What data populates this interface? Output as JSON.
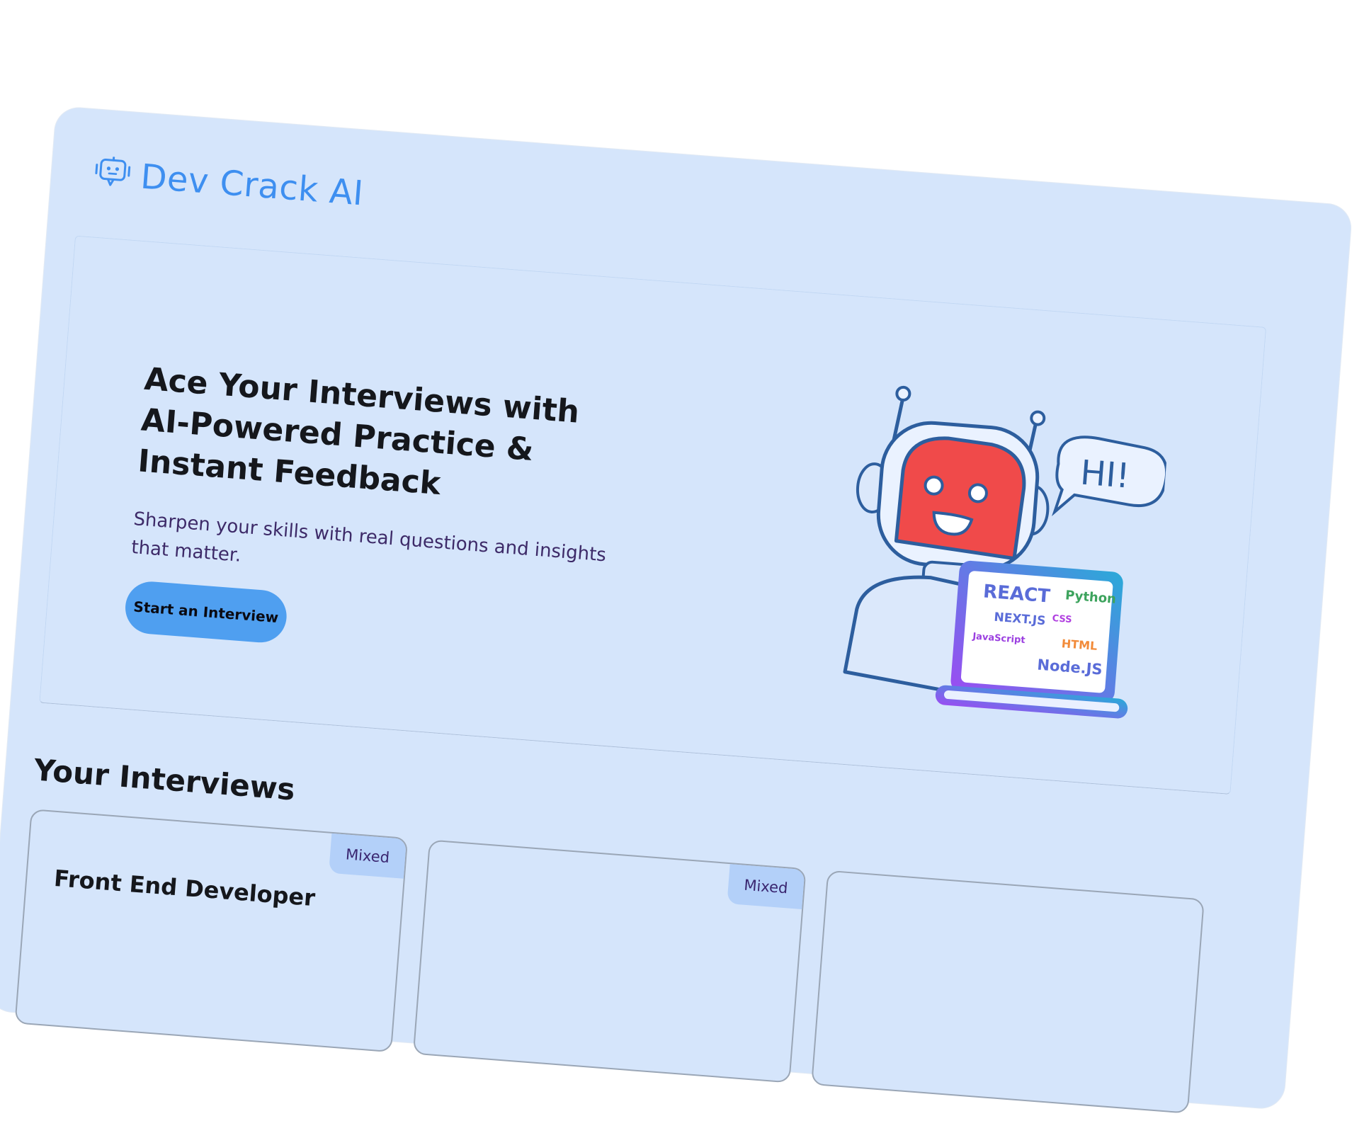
{
  "brand": {
    "name": "Dev Crack AI",
    "icon": "chat-robot-icon",
    "color": "#3e8ff0"
  },
  "hero": {
    "title": "Ace Your Interviews with AI-Powered Practice & Instant Feedback",
    "subtitle": "Sharpen your skills with real questions and insights that matter.",
    "cta_label": "Start an Interview",
    "illustration": {
      "speech": "HI!",
      "tech_labels": [
        "REACT",
        "Python",
        "NEXT.JS",
        "CSS",
        "JavaScript",
        "HTML",
        "Node.JS"
      ]
    }
  },
  "interviews": {
    "section_title": "Your Interviews",
    "cards": [
      {
        "badge": "Mixed",
        "title": "Front End Developer"
      },
      {
        "badge": "Mixed",
        "title": ""
      },
      {
        "badge": "",
        "title": ""
      }
    ]
  },
  "colors": {
    "background": "#d5e5fb",
    "accent": "#4f9ff0",
    "badge_bg": "#b3d0f9",
    "robot_face": "#f04a4a"
  }
}
